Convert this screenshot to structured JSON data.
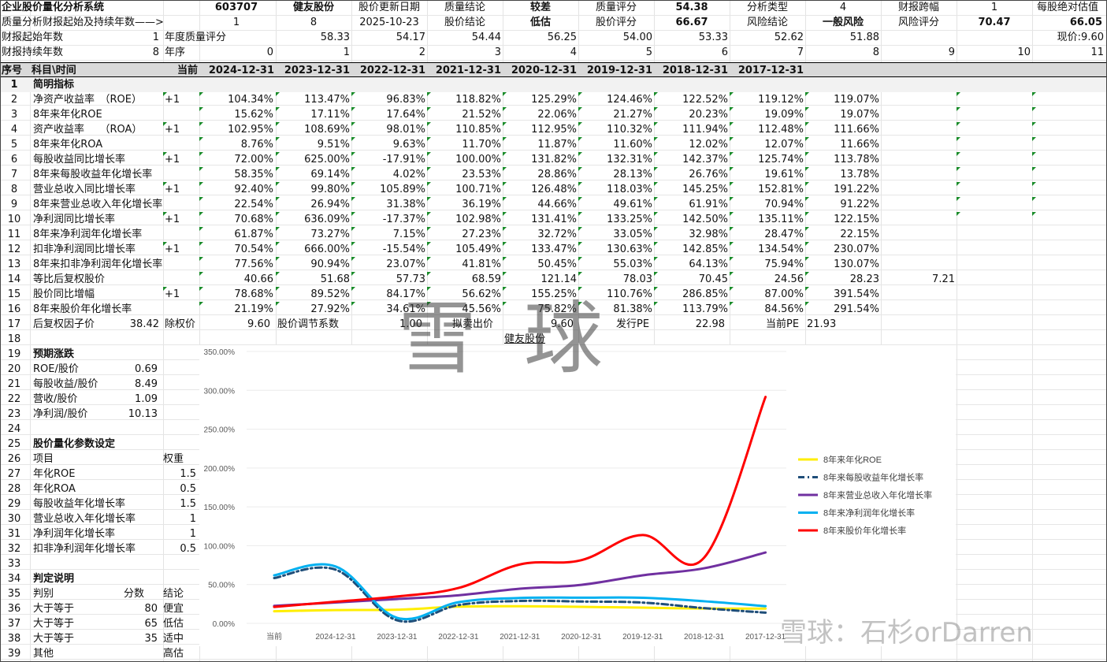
{
  "top": {
    "r1": [
      "企业股价量化分析系统",
      "603707",
      "健友股份",
      "股价更新日期",
      "质量结论",
      "较差",
      "质量评分",
      "54.38",
      "分析类型",
      "4",
      "财报跨幅",
      "1",
      "每股绝对估值"
    ],
    "r2": [
      "质量分析财报起始及持续年数——>",
      "1",
      "8",
      "2025-10-23",
      "股价结论",
      "低估",
      "股价评分",
      "66.67",
      "风险结论",
      "一般风险",
      "风险评分",
      "70.47",
      "66.05"
    ],
    "r3": [
      "财报起始年数",
      "1",
      "年度质量评分",
      "58.33",
      "54.17",
      "54.44",
      "56.25",
      "54.00",
      "53.33",
      "52.62",
      "51.88",
      "现价:9.60"
    ],
    "r4": [
      "财报持续年数",
      "8",
      "年序",
      "0",
      "1",
      "2",
      "3",
      "4",
      "5",
      "6",
      "7",
      "8",
      "9",
      "10",
      "11"
    ]
  },
  "header": [
    "序号",
    "科目\\时间",
    "当前",
    "2024-12-31",
    "2023-12-31",
    "2022-12-31",
    "2021-12-31",
    "2020-12-31",
    "2019-12-31",
    "2018-12-31",
    "2017-12-31"
  ],
  "section1": {
    "num": "1",
    "label": "简明指标"
  },
  "rows": [
    {
      "n": "2",
      "label": "净资产收益率　（ROE）",
      "tag": "+1",
      "v": [
        "104.34%",
        "113.47%",
        "96.83%",
        "118.82%",
        "125.29%",
        "124.46%",
        "122.52%",
        "119.12%",
        "119.07%"
      ]
    },
    {
      "n": "3",
      "label": "8年来年化ROE",
      "tag": "",
      "v": [
        "15.62%",
        "17.11%",
        "17.64%",
        "21.52%",
        "22.06%",
        "21.27%",
        "20.23%",
        "19.09%",
        "19.07%"
      ]
    },
    {
      "n": "4",
      "label": "资产收益率　　（ROA）",
      "tag": "+1",
      "v": [
        "102.95%",
        "108.69%",
        "98.01%",
        "110.85%",
        "112.95%",
        "110.32%",
        "111.94%",
        "112.48%",
        "111.66%"
      ]
    },
    {
      "n": "5",
      "label": "8年来年化ROA",
      "tag": "",
      "v": [
        "8.76%",
        "9.51%",
        "9.63%",
        "11.70%",
        "11.87%",
        "11.60%",
        "12.02%",
        "12.07%",
        "11.66%"
      ]
    },
    {
      "n": "6",
      "label": "每股收益同比增长率",
      "tag": "+1",
      "v": [
        "72.00%",
        "625.00%",
        "-17.91%",
        "100.00%",
        "131.82%",
        "132.31%",
        "142.37%",
        "125.74%",
        "113.78%"
      ]
    },
    {
      "n": "7",
      "label": "8年来每股收益年化增长率",
      "tag": "",
      "v": [
        "58.35%",
        "69.14%",
        "4.02%",
        "23.53%",
        "28.86%",
        "28.13%",
        "26.76%",
        "19.61%",
        "13.78%"
      ]
    },
    {
      "n": "8",
      "label": "营业总收入同比增长率",
      "tag": "+1",
      "v": [
        "92.40%",
        "99.80%",
        "105.89%",
        "100.71%",
        "126.48%",
        "118.03%",
        "145.25%",
        "152.81%",
        "191.22%"
      ]
    },
    {
      "n": "9",
      "label": "8年来营业总收入年化增长率",
      "tag": "",
      "v": [
        "22.54%",
        "26.94%",
        "31.38%",
        "36.19%",
        "44.66%",
        "49.61%",
        "61.91%",
        "70.94%",
        "91.22%"
      ]
    },
    {
      "n": "10",
      "label": "净利润同比增长率",
      "tag": "+1",
      "v": [
        "70.68%",
        "636.09%",
        "-17.37%",
        "102.98%",
        "131.41%",
        "133.25%",
        "142.50%",
        "135.11%",
        "122.15%"
      ]
    },
    {
      "n": "11",
      "label": "8年来净利润年化增长率",
      "tag": "",
      "v": [
        "61.87%",
        "73.27%",
        "7.15%",
        "27.23%",
        "32.72%",
        "33.05%",
        "32.98%",
        "28.47%",
        "22.15%"
      ]
    },
    {
      "n": "12",
      "label": "扣非净利润同比增长率",
      "tag": "+1",
      "v": [
        "70.54%",
        "666.00%",
        "-15.54%",
        "105.49%",
        "133.47%",
        "130.63%",
        "142.85%",
        "134.54%",
        "230.07%"
      ]
    },
    {
      "n": "13",
      "label": "8年来扣非净利润年化增长率",
      "tag": "",
      "v": [
        "77.56%",
        "90.94%",
        "23.07%",
        "41.81%",
        "50.45%",
        "55.03%",
        "64.13%",
        "75.94%",
        "130.07%"
      ]
    },
    {
      "n": "14",
      "label": "等比后复权股价",
      "tag": "",
      "v": [
        "40.66",
        "51.68",
        "57.73",
        "68.59",
        "121.14",
        "78.03",
        "70.45",
        "24.56",
        "28.23",
        "7.21"
      ]
    },
    {
      "n": "15",
      "label": "股价同比增幅",
      "tag": "+1",
      "v": [
        "78.68%",
        "89.52%",
        "84.17%",
        "56.62%",
        "155.25%",
        "110.76%",
        "286.85%",
        "87.00%",
        "391.54%"
      ]
    },
    {
      "n": "16",
      "label": "8年来股价年化增长率",
      "tag": "",
      "v": [
        "21.19%",
        "27.92%",
        "34.61%",
        "45.56%",
        "75.82%",
        "81.38%",
        "113.79%",
        "84.56%",
        "291.54%"
      ]
    }
  ],
  "row17": [
    "17",
    "后复权因子价",
    "38.42",
    "除权价",
    "9.60",
    "股价调节系数",
    "1.00",
    "拟卖出价",
    "9.60",
    "发行PE",
    "22.98",
    "当前PE",
    "21.93"
  ],
  "row18": {
    "n": "18",
    "link": "健友股份"
  },
  "left_panel": [
    {
      "n": "19",
      "a": "预期涨跌",
      "b": "",
      "bold": true
    },
    {
      "n": "20",
      "a": "ROE/股价",
      "b": "0.69"
    },
    {
      "n": "21",
      "a": "每股收益/股价",
      "b": "8.49"
    },
    {
      "n": "22",
      "a": "营收/股价",
      "b": "1.09"
    },
    {
      "n": "23",
      "a": "净利润/股价",
      "b": "10.13"
    },
    {
      "n": "24",
      "a": "",
      "b": ""
    },
    {
      "n": "25",
      "a": "股价量化参数设定",
      "b": "",
      "bold": true
    },
    {
      "n": "26",
      "a": "项目",
      "b": "",
      "c": "权重"
    },
    {
      "n": "27",
      "a": "年化ROE",
      "b": "",
      "c": "1.5"
    },
    {
      "n": "28",
      "a": "年化ROA",
      "b": "",
      "c": "0.5"
    },
    {
      "n": "29",
      "a": "每股收益年化增长率",
      "b": "",
      "c": "1.5"
    },
    {
      "n": "30",
      "a": "营业总收入年化增长率",
      "b": "",
      "c": "1"
    },
    {
      "n": "31",
      "a": "净利润年化增长率",
      "b": "",
      "c": "1"
    },
    {
      "n": "32",
      "a": "扣非净利润年化增长率",
      "b": "",
      "c": "0.5"
    },
    {
      "n": "33",
      "a": "",
      "b": ""
    },
    {
      "n": "34",
      "a": "判定说明",
      "b": "",
      "bold": true
    },
    {
      "n": "35",
      "a": "判别",
      "b": "分数",
      "c": "结论"
    },
    {
      "n": "36",
      "a": "大于等于",
      "b": "80",
      "c": "便宜"
    },
    {
      "n": "37",
      "a": "大于等于",
      "b": "65",
      "c": "低估"
    },
    {
      "n": "38",
      "a": "大于等于",
      "b": "35",
      "c": "适中"
    },
    {
      "n": "39",
      "a": "其他",
      "b": "",
      "c": "高估"
    }
  ],
  "watermarks": {
    "center": "雪球",
    "bottom": "雪球：石杉orDarren"
  },
  "chart_data": {
    "type": "line",
    "categories": [
      "当前",
      "2024-12-31",
      "2023-12-31",
      "2022-12-31",
      "2021-12-31",
      "2020-12-31",
      "2019-12-31",
      "2018-12-31",
      "2017-12-31"
    ],
    "ylim": [
      0,
      350
    ],
    "yticks": [
      "0.00%",
      "50.00%",
      "100.00%",
      "150.00%",
      "200.00%",
      "250.00%",
      "300.00%",
      "350.00%"
    ],
    "grid": true,
    "legend": "right",
    "series": [
      {
        "name": "8年来年化ROE",
        "color": "#ffee00",
        "dash": "",
        "values": [
          15.62,
          17.11,
          17.64,
          21.52,
          22.06,
          21.27,
          20.23,
          19.09,
          19.07
        ]
      },
      {
        "name": "8年来每股收益年化增长率",
        "color": "#1f4e79",
        "dash": "8,4,2,4",
        "values": [
          58.35,
          69.14,
          4.02,
          23.53,
          28.86,
          28.13,
          26.76,
          19.61,
          13.78
        ]
      },
      {
        "name": "8年来营业总收入年化增长率",
        "color": "#7030a0",
        "dash": "",
        "values": [
          22.54,
          26.94,
          31.38,
          36.19,
          44.66,
          49.61,
          61.91,
          70.94,
          91.22
        ]
      },
      {
        "name": "8年来净利润年化增长率",
        "color": "#00b0f0",
        "dash": "",
        "values": [
          61.87,
          73.27,
          7.15,
          27.23,
          32.72,
          33.05,
          32.98,
          28.47,
          22.15
        ]
      },
      {
        "name": "8年来股价年化增长率",
        "color": "#ff0000",
        "dash": "",
        "values": [
          21.19,
          27.92,
          34.61,
          45.56,
          75.82,
          81.38,
          113.79,
          84.56,
          291.54
        ]
      }
    ]
  }
}
